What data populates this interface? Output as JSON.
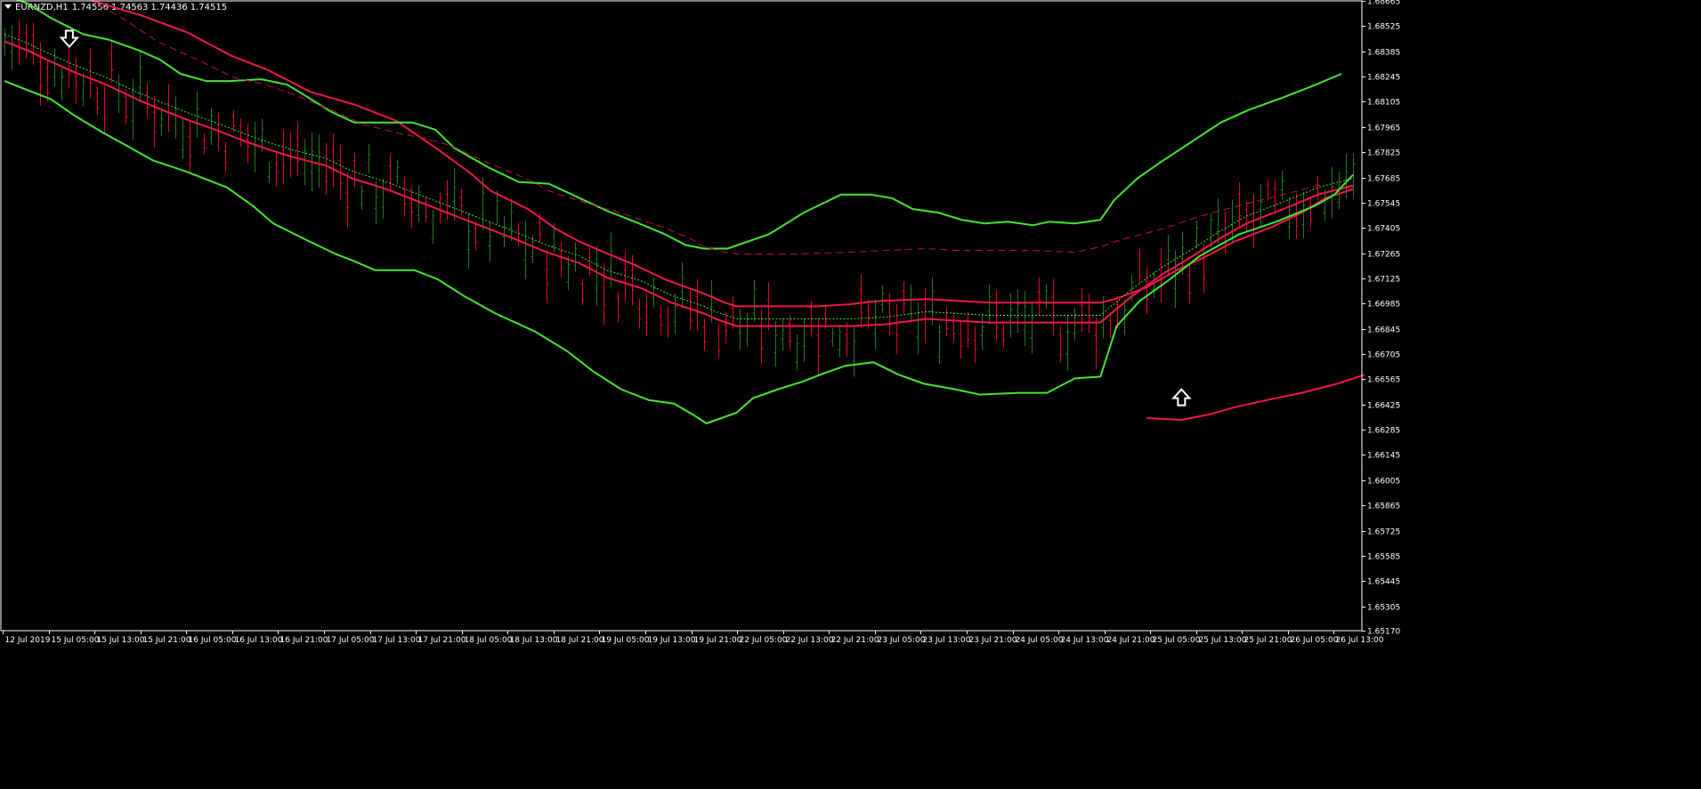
{
  "window": {
    "symbol": "EURNZD,H1",
    "quote": {
      "open": "1.74556",
      "high": "1.74563",
      "low": "1.74436",
      "close": "1.74515"
    }
  },
  "colors": {
    "background": "#000000",
    "axis": "#ffffff",
    "bull_bar": "#1f7a1f",
    "bear_bar": "#e8002c",
    "envelope_green": "#46e62e",
    "envelope_red": "#f0174a",
    "midline_green_dotted": "#46e62e",
    "midline_red_dashed": "#c0103a",
    "arrow": "#ffffff"
  },
  "chart_data": {
    "type": "line",
    "instrument": "EURNZD",
    "timeframe": "H1",
    "price_axis": {
      "min": 1.6517,
      "max": 1.68665,
      "ticks": [
        "1.68665",
        "1.68525",
        "1.68385",
        "1.68245",
        "1.68105",
        "1.67965",
        "1.67825",
        "1.67685",
        "1.67545",
        "1.67405",
        "1.67265",
        "1.67125",
        "1.66985",
        "1.66845",
        "1.66705",
        "1.66565",
        "1.66425",
        "1.66285",
        "1.66145",
        "1.66005",
        "1.65865",
        "1.65725",
        "1.65585",
        "1.65445",
        "1.65305",
        "1.65170"
      ]
    },
    "time_axis": {
      "ticks": [
        "12 Jul 2019",
        "15 Jul 05:00",
        "15 Jul 13:00",
        "15 Jul 21:00",
        "16 Jul 05:00",
        "16 Jul 13:00",
        "16 Jul 21:00",
        "17 Jul 05:00",
        "17 Jul 13:00",
        "17 Jul 21:00",
        "18 Jul 05:00",
        "18 Jul 13:00",
        "18 Jul 21:00",
        "19 Jul 05:00",
        "19 Jul 13:00",
        "19 Jul 21:00",
        "22 Jul 05:00",
        "22 Jul 13:00",
        "22 Jul 21:00",
        "23 Jul 05:00",
        "23 Jul 13:00",
        "23 Jul 21:00",
        "24 Jul 05:00",
        "24 Jul 13:00",
        "24 Jul 21:00",
        "25 Jul 05:00",
        "25 Jul 13:00",
        "25 Jul 21:00",
        "26 Jul 05:00",
        "26 Jul 13:00"
      ]
    },
    "bars_count": 190,
    "series": [
      {
        "role": "red-upper",
        "points": [
          [
            37,
            1.6867
          ],
          [
            60,
            1.6858
          ],
          [
            79,
            1.6849
          ],
          [
            98,
            1.6836
          ],
          [
            114,
            1.6828
          ],
          [
            132,
            1.6816
          ],
          [
            151,
            1.6809
          ],
          [
            169,
            1.68
          ],
          [
            186,
            1.6785
          ],
          [
            200,
            1.6772
          ],
          [
            210,
            1.6761
          ],
          [
            226,
            1.6751
          ],
          [
            238,
            1.674
          ],
          [
            248,
            1.6733
          ],
          [
            257,
            1.6728
          ],
          [
            272,
            1.672
          ],
          [
            285,
            1.6712
          ],
          [
            302,
            1.6704
          ],
          [
            311,
            1.6699
          ],
          [
            316,
            1.6697
          ],
          [
            331,
            1.6697
          ],
          [
            351,
            1.6697
          ],
          [
            364,
            1.6698
          ],
          [
            378,
            1.67
          ],
          [
            398,
            1.6701
          ],
          [
            412,
            1.67
          ],
          [
            425,
            1.6699
          ],
          [
            444,
            1.6699
          ],
          [
            462,
            1.6699
          ],
          [
            473,
            1.6699
          ],
          [
            479,
            1.6701
          ],
          [
            492,
            1.6707
          ],
          [
            506,
            1.6717
          ],
          [
            519,
            1.6725
          ],
          [
            531,
            1.6733
          ],
          [
            547,
            1.6741
          ],
          [
            560,
            1.6749
          ],
          [
            570,
            1.6757
          ],
          [
            582,
            1.6762
          ]
        ]
      },
      {
        "role": "green-upper",
        "points": [
          [
            0,
            1.687
          ],
          [
            10,
            1.6865
          ],
          [
            20,
            1.6857
          ],
          [
            34,
            1.6848
          ],
          [
            45,
            1.6845
          ],
          [
            58,
            1.6839
          ],
          [
            67,
            1.6834
          ],
          [
            76,
            1.6826
          ],
          [
            87,
            1.6822
          ],
          [
            97,
            1.6822
          ],
          [
            111,
            1.6823
          ],
          [
            122,
            1.682
          ],
          [
            131,
            1.6813
          ],
          [
            141,
            1.6805
          ],
          [
            151,
            1.6799
          ],
          [
            163,
            1.6799
          ],
          [
            176,
            1.6799
          ],
          [
            186,
            1.6795
          ],
          [
            194,
            1.6785
          ],
          [
            209,
            1.6774
          ],
          [
            222,
            1.6766
          ],
          [
            235,
            1.6765
          ],
          [
            245,
            1.6759
          ],
          [
            260,
            1.675
          ],
          [
            272,
            1.6744
          ],
          [
            285,
            1.6737
          ],
          [
            294,
            1.6731
          ],
          [
            302,
            1.6729
          ],
          [
            312,
            1.6729
          ],
          [
            330,
            1.6737
          ],
          [
            345,
            1.6749
          ],
          [
            361,
            1.6759
          ],
          [
            374,
            1.6759
          ],
          [
            383,
            1.6757
          ],
          [
            392,
            1.6751
          ],
          [
            403,
            1.6749
          ],
          [
            413,
            1.6745
          ],
          [
            423,
            1.6743
          ],
          [
            433,
            1.6744
          ],
          [
            444,
            1.6742
          ],
          [
            451,
            1.6744
          ],
          [
            462,
            1.6743
          ],
          [
            473,
            1.6745
          ],
          [
            479,
            1.6756
          ],
          [
            489,
            1.6768
          ],
          [
            499,
            1.6777
          ],
          [
            512,
            1.6788
          ],
          [
            525,
            1.6799
          ],
          [
            537,
            1.6806
          ],
          [
            552,
            1.6813
          ],
          [
            566,
            1.682
          ],
          [
            577,
            1.6826
          ]
        ]
      },
      {
        "role": "red-middle-dashed",
        "points": [
          [
            37,
            1.6867
          ],
          [
            52,
            1.6856
          ],
          [
            66,
            1.6844
          ],
          [
            83,
            1.6834
          ],
          [
            99,
            1.6824
          ],
          [
            113,
            1.682
          ],
          [
            126,
            1.6814
          ],
          [
            141,
            1.6806
          ],
          [
            155,
            1.6798
          ],
          [
            170,
            1.6793
          ],
          [
            182,
            1.679
          ],
          [
            193,
            1.6786
          ],
          [
            208,
            1.6777
          ],
          [
            225,
            1.6768
          ],
          [
            237,
            1.676
          ],
          [
            252,
            1.6754
          ],
          [
            268,
            1.6748
          ],
          [
            284,
            1.6741
          ],
          [
            297,
            1.6734
          ],
          [
            302,
            1.673
          ],
          [
            311,
            1.6727
          ],
          [
            316,
            1.6726
          ],
          [
            341,
            1.6726
          ],
          [
            365,
            1.6727
          ],
          [
            380,
            1.6728
          ],
          [
            398,
            1.6729
          ],
          [
            412,
            1.6728
          ],
          [
            425,
            1.6728
          ],
          [
            444,
            1.6728
          ],
          [
            462,
            1.6727
          ],
          [
            473,
            1.673
          ],
          [
            482,
            1.6734
          ],
          [
            500,
            1.674
          ],
          [
            516,
            1.6747
          ],
          [
            533,
            1.6753
          ],
          [
            552,
            1.6759
          ],
          [
            570,
            1.6765
          ]
        ]
      },
      {
        "role": "red-center",
        "points": [
          [
            0,
            1.6844
          ],
          [
            10,
            1.6839
          ],
          [
            18,
            1.6834
          ],
          [
            30,
            1.6827
          ],
          [
            44,
            1.682
          ],
          [
            57,
            1.6812
          ],
          [
            68,
            1.6806
          ],
          [
            80,
            1.68
          ],
          [
            91,
            1.6795
          ],
          [
            103,
            1.6789
          ],
          [
            114,
            1.6784
          ],
          [
            124,
            1.678
          ],
          [
            139,
            1.6775
          ],
          [
            150,
            1.6768
          ],
          [
            165,
            1.6762
          ],
          [
            179,
            1.6755
          ],
          [
            193,
            1.6748
          ],
          [
            207,
            1.6741
          ],
          [
            221,
            1.6734
          ],
          [
            234,
            1.6727
          ],
          [
            248,
            1.6721
          ],
          [
            260,
            1.6713
          ],
          [
            275,
            1.6707
          ],
          [
            288,
            1.6699
          ],
          [
            302,
            1.6693
          ],
          [
            307,
            1.669
          ],
          [
            316,
            1.6686
          ],
          [
            331,
            1.6686
          ],
          [
            351,
            1.6686
          ],
          [
            365,
            1.6686
          ],
          [
            380,
            1.6687
          ],
          [
            398,
            1.669
          ],
          [
            412,
            1.6689
          ],
          [
            425,
            1.6688
          ],
          [
            444,
            1.6688
          ],
          [
            462,
            1.6688
          ],
          [
            473,
            1.6688
          ],
          [
            486,
            1.6702
          ],
          [
            500,
            1.6715
          ],
          [
            513,
            1.6725
          ],
          [
            525,
            1.6735
          ],
          [
            536,
            1.6743
          ],
          [
            552,
            1.6751
          ],
          [
            567,
            1.6759
          ],
          [
            582,
            1.6764
          ]
        ]
      },
      {
        "role": "green-lower",
        "points": [
          [
            0,
            1.6822
          ],
          [
            10,
            1.6817
          ],
          [
            20,
            1.6812
          ],
          [
            30,
            1.6803
          ],
          [
            43,
            1.6793
          ],
          [
            53,
            1.6786
          ],
          [
            64,
            1.6778
          ],
          [
            78,
            1.6772
          ],
          [
            96,
            1.6763
          ],
          [
            107,
            1.6753
          ],
          [
            116,
            1.6743
          ],
          [
            130,
            1.6734
          ],
          [
            143,
            1.6726
          ],
          [
            151,
            1.6722
          ],
          [
            160,
            1.6717
          ],
          [
            177,
            1.6717
          ],
          [
            187,
            1.6712
          ],
          [
            198,
            1.6703
          ],
          [
            212,
            1.6693
          ],
          [
            229,
            1.6683
          ],
          [
            243,
            1.6672
          ],
          [
            254,
            1.6661
          ],
          [
            266,
            1.6651
          ],
          [
            278,
            1.6645
          ],
          [
            289,
            1.6643
          ],
          [
            297,
            1.6637
          ],
          [
            303,
            1.6632
          ],
          [
            316,
            1.6638
          ],
          [
            323,
            1.6646
          ],
          [
            334,
            1.6651
          ],
          [
            344,
            1.6655
          ],
          [
            354,
            1.666
          ],
          [
            363,
            1.6664
          ],
          [
            375,
            1.6666
          ],
          [
            386,
            1.6659
          ],
          [
            397,
            1.6654
          ],
          [
            410,
            1.6651
          ],
          [
            421,
            1.6648
          ],
          [
            438,
            1.6649
          ],
          [
            450,
            1.6649
          ],
          [
            462,
            1.6657
          ],
          [
            473,
            1.6658
          ],
          [
            480,
            1.6686
          ],
          [
            490,
            1.67
          ],
          [
            503,
            1.6712
          ],
          [
            516,
            1.6725
          ],
          [
            533,
            1.6737
          ],
          [
            549,
            1.6744
          ],
          [
            566,
            1.6753
          ],
          [
            574,
            1.6759
          ],
          [
            582,
            1.677
          ]
        ]
      },
      {
        "role": "red-lower",
        "points": [
          [
            493,
            1.6635
          ],
          [
            508,
            1.6634
          ],
          [
            520,
            1.6637
          ],
          [
            531,
            1.6641
          ],
          [
            545,
            1.6645
          ],
          [
            560,
            1.6649
          ],
          [
            575,
            1.6654
          ],
          [
            587,
            1.6659
          ]
        ]
      }
    ],
    "arrows": [
      {
        "type": "down",
        "price": 1.6845
      },
      {
        "type": "up",
        "price": 1.6647
      }
    ]
  }
}
